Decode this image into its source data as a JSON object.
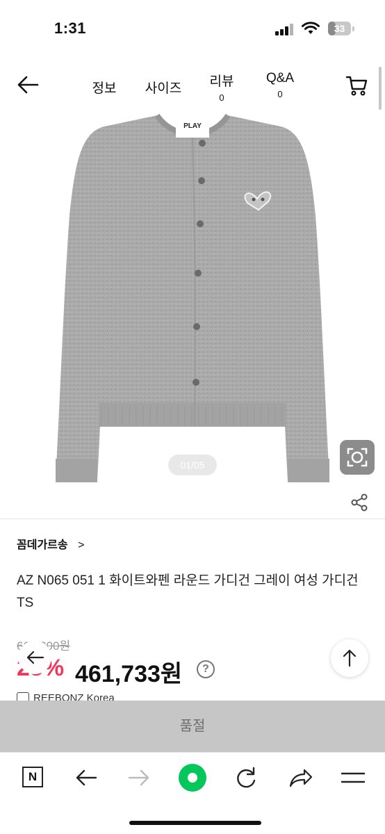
{
  "status_bar": {
    "time": "1:31",
    "battery_level": "33",
    "icons": [
      "signal-icon",
      "wifi-icon",
      "battery-icon"
    ]
  },
  "nav": {
    "tabs": [
      {
        "label": "정보"
      },
      {
        "label": "사이즈"
      },
      {
        "label": "리뷰",
        "count": "0"
      },
      {
        "label": "Q&A",
        "count": "0"
      }
    ],
    "icons": {
      "back": "arrow-left-icon",
      "cart": "cart-icon"
    }
  },
  "gallery": {
    "page_indicator": "01/05",
    "logo_text": "PLAY",
    "icons": {
      "scan": "image-search-icon",
      "share": "share-icon"
    },
    "colors": {
      "sweater": "#a9a9a9",
      "button": "#6a6a6a"
    }
  },
  "product": {
    "brand": "꼼데가르송",
    "brand_chevron": ">",
    "name": "AZ N065 051 1 화이트와펜 라운드 가디건 그레이 여성 가디건 TS",
    "original_price": "664,300원",
    "discount": "25%",
    "sale_price": "461,733원",
    "help_icon_label": "?",
    "seller": "REEBONZ Korea"
  },
  "actions": {
    "sold_out_label": "품절"
  },
  "browser_toolbar": {
    "items": [
      "naver-icon",
      "back-icon",
      "forward-icon",
      "green-dot-icon",
      "refresh-icon",
      "share-icon",
      "menu-icon"
    ],
    "n_logo": "N",
    "accent_color": "#03c75a"
  },
  "colors": {
    "discount": "#f0385a",
    "sold_out_bar": "#c6c6c6"
  }
}
